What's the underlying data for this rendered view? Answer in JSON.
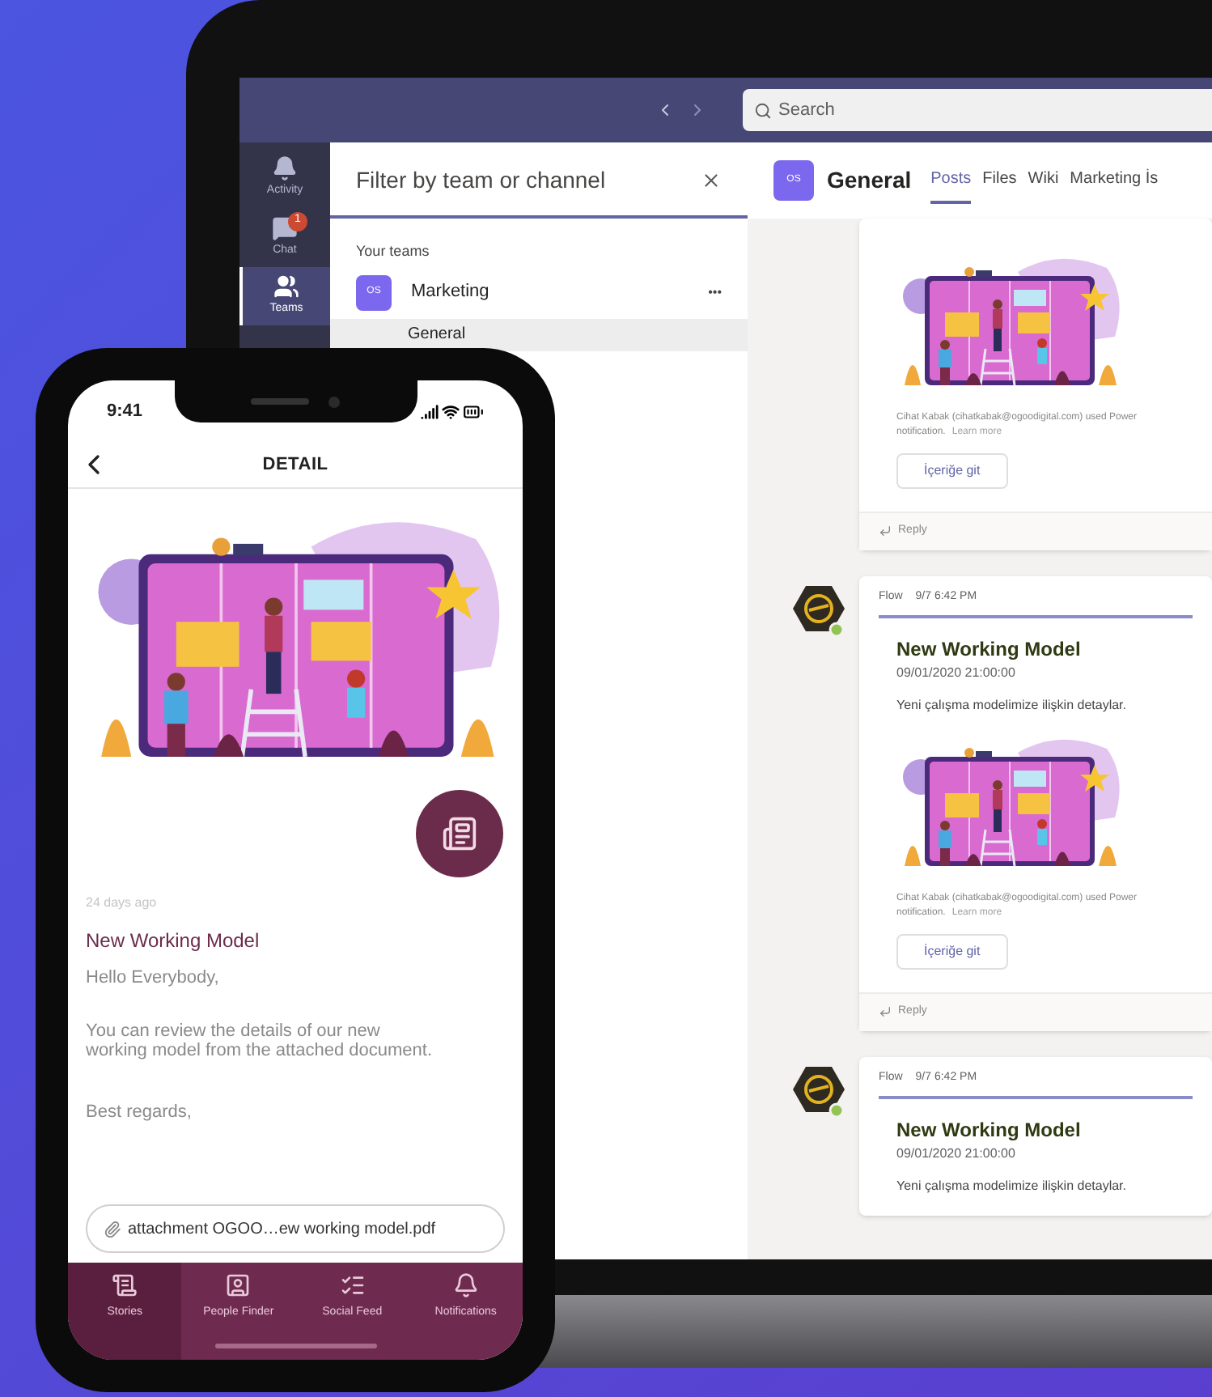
{
  "laptop": {
    "search": {
      "placeholder": "Search"
    },
    "rail": [
      {
        "label": "Activity",
        "selected": false
      },
      {
        "label": "Chat",
        "selected": false,
        "badge": "1"
      },
      {
        "label": "Teams",
        "selected": true
      }
    ],
    "filter": {
      "placeholder": "Filter by team or channel"
    },
    "teams_heading": "Your teams",
    "teams": [
      {
        "avatar": "OS",
        "name": "Marketing",
        "more": "•••",
        "channels": [
          {
            "name": "General",
            "selected": true
          }
        ]
      }
    ],
    "channel_header": {
      "avatar": "OS",
      "title": "General",
      "tabs": [
        {
          "label": "Posts",
          "selected": true
        },
        {
          "label": "Files",
          "selected": false
        },
        {
          "label": "Wiki",
          "selected": false
        },
        {
          "label": "Marketing İs",
          "selected": false
        }
      ]
    },
    "posts": [
      {
        "kind": "continued",
        "image": true,
        "notice": "Cihat Kabak (cihatkabak@ogoodigital.com) used Power",
        "notice_end": "notification.",
        "notice_link": "Learn more",
        "button": "İçeriğe git",
        "reply": "Reply"
      },
      {
        "kind": "message",
        "author": "Flow",
        "time": "9/7 6:42 PM",
        "title": "New Working Model",
        "date": "09/01/2020 21:00:00",
        "description": "Yeni çalışma modelimize ilişkin detaylar.",
        "image": true,
        "notice": "Cihat Kabak (cihatkabak@ogoodigital.com) used Power",
        "notice_end": "notification.",
        "notice_link": "Learn more",
        "button": "İçeriğe git",
        "reply": "Reply"
      },
      {
        "kind": "message",
        "author": "Flow",
        "time": "9/7 6:42 PM",
        "title": "New Working Model",
        "date": "09/01/2020 21:00:00",
        "description": "Yeni çalışma modelimize ilişkin detaylar."
      }
    ]
  },
  "phone": {
    "time": "9:41",
    "title": "DETAIL",
    "age": "24 days ago",
    "post_title": "New Working Model",
    "greeting": "Hello Everybody,",
    "body": "You can review the details of our new working model from the attached document.",
    "closing": "Best regards,",
    "attachment": "attachment OGOO…ew working model.pdf",
    "nav": [
      {
        "label": "Stories",
        "selected": true
      },
      {
        "label": "People Finder",
        "selected": false
      },
      {
        "label": "Social Feed",
        "selected": false
      },
      {
        "label": "Notifications",
        "selected": false
      }
    ]
  }
}
